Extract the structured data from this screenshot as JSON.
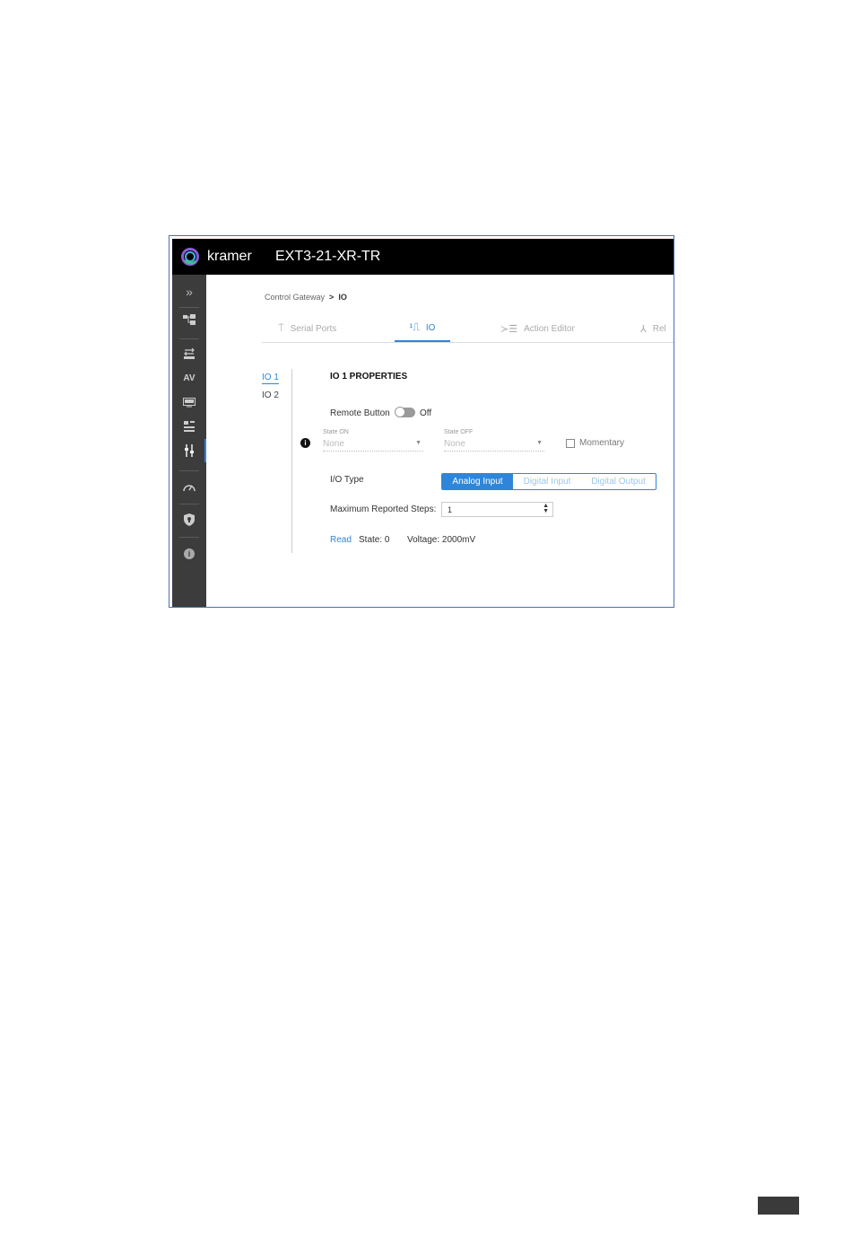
{
  "header": {
    "brand": "kramer",
    "device_name": "EXT3-21-XR-TR"
  },
  "sidebar": {
    "items": [
      {
        "icon": "double-chevron-right-icon",
        "label": "»"
      },
      {
        "icon": "network-icon"
      },
      {
        "icon": "auto-switch-icon"
      },
      {
        "icon": "av-icon",
        "label": "AV"
      },
      {
        "icon": "edid-icon"
      },
      {
        "icon": "routing-icon"
      },
      {
        "icon": "control-gateway-icon",
        "active": true
      },
      {
        "icon": "dashboard-icon"
      },
      {
        "icon": "security-shield-icon"
      },
      {
        "icon": "info-icon",
        "label": "i"
      }
    ]
  },
  "breadcrumb": {
    "parent": "Control Gateway",
    "separator": ">",
    "current": "IO"
  },
  "tabs": [
    {
      "label": "Serial Ports",
      "icon": "serial-port-icon",
      "glyph": "⍑"
    },
    {
      "label": "IO",
      "icon": "io-icon",
      "glyph": "¹⎍",
      "active": true
    },
    {
      "label": "Action Editor",
      "icon": "action-editor-icon",
      "glyph": "≻☰"
    },
    {
      "label": "Rel",
      "icon": "relay-icon",
      "glyph": "⅄"
    }
  ],
  "io_list": [
    "IO 1",
    "IO 2"
  ],
  "properties": {
    "title": "IO 1 PROPERTIES",
    "remote_button_label": "Remote Button",
    "remote_button_state": "Off",
    "info_glyph": "i",
    "state_on": {
      "label": "State ON",
      "value": "None"
    },
    "state_off": {
      "label": "State OFF",
      "value": "None"
    },
    "momentary_label": "Momentary",
    "io_type_label": "I/O Type",
    "io_type_options": [
      "Analog Input",
      "Digital Input",
      "Digital Output"
    ],
    "io_type_selected": "Analog Input",
    "max_steps_label": "Maximum Reported Steps:",
    "max_steps_value": "1",
    "read_label": "Read",
    "state_text": "State: 0",
    "voltage_text": "Voltage: 2000mV"
  },
  "colors": {
    "accent": "#2f86d8",
    "topbar": "#000000",
    "sidebar": "#3c3c3c",
    "frame_border": "#4a6fb3"
  }
}
